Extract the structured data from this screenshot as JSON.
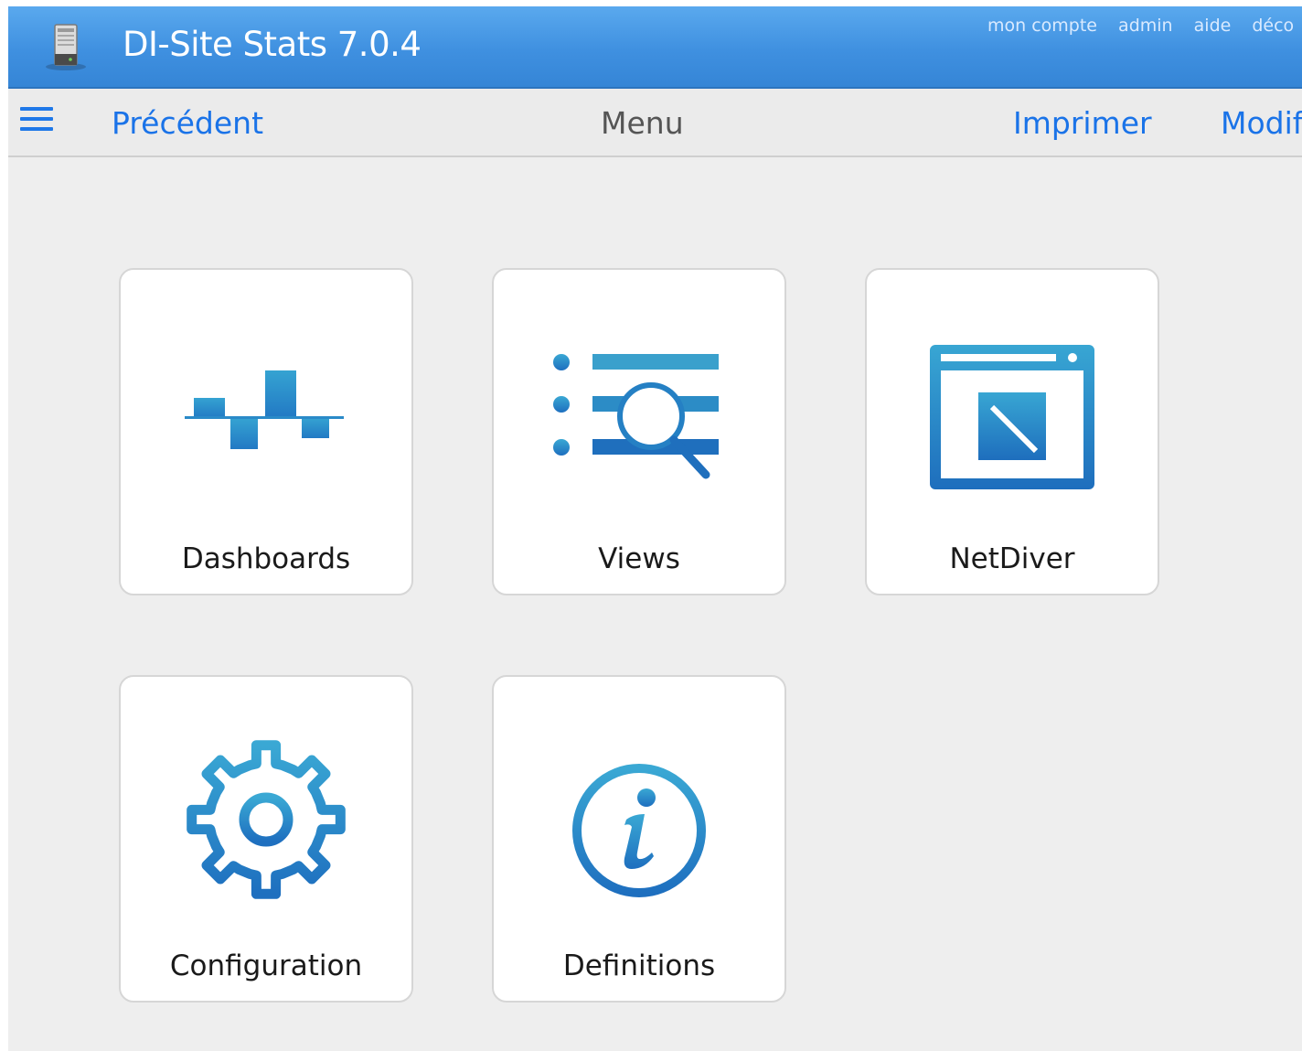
{
  "header": {
    "title": "DI-Site Stats 7.0.4",
    "links": [
      "mon compte",
      "admin",
      "aide",
      "déco"
    ]
  },
  "navbar": {
    "back_label": "Précédent",
    "title": "Menu",
    "print_label": "Imprimer",
    "edit_label": "Modif"
  },
  "tiles": [
    {
      "label": "Dashboards",
      "icon": "dashboard-chart-icon"
    },
    {
      "label": "Views",
      "icon": "views-list-search-icon"
    },
    {
      "label": "NetDiver",
      "icon": "netdiver-window-icon"
    },
    {
      "label": "Configuration",
      "icon": "gear-icon"
    },
    {
      "label": "Definitions",
      "icon": "info-icon"
    }
  ],
  "colors": {
    "header_blue": "#4a9ce8",
    "link_blue": "#1a73e8",
    "icon_blue": "#2a8bc9"
  }
}
